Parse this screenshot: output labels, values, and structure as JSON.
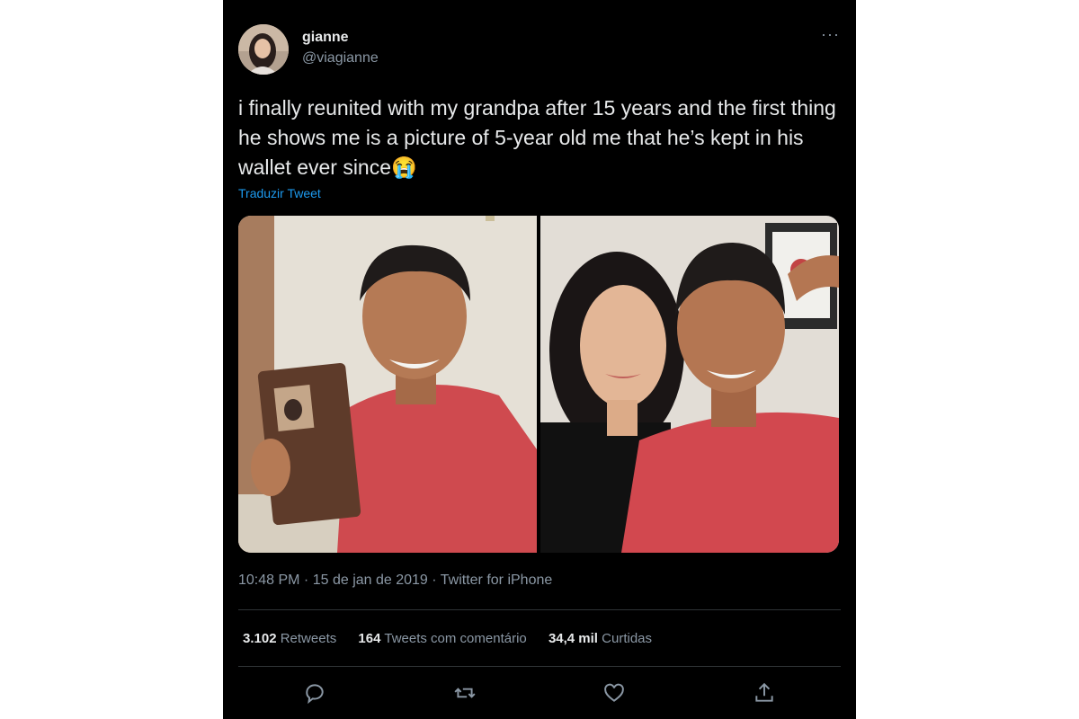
{
  "author": {
    "name": "gianne",
    "handle": "@viagianne"
  },
  "more_label": "···",
  "tweet": {
    "text": "i finally reunited with my grandpa after 15 years and the first thing he shows me is a picture of 5-year old me that he’s kept in his wallet ever since😭",
    "translate": "Traduzir Tweet"
  },
  "meta": {
    "time": "10:48 PM",
    "sep1": " · ",
    "date": "15 de jan de 2019",
    "sep2": " · ",
    "source": "Twitter for iPhone"
  },
  "stats": {
    "retweets_count": "3.102",
    "retweets_label": "Retweets",
    "quotes_count": "164",
    "quotes_label": "Tweets com comentário",
    "likes_count": "34,4 mil",
    "likes_label": "Curtidas"
  },
  "icons": [
    "reply-icon",
    "retweet-icon",
    "like-icon",
    "share-icon"
  ],
  "colors": {
    "background": "#000000",
    "text": "#e7e9ea",
    "secondary": "#8b98a5",
    "link": "#1d9bf0",
    "divider": "#2f3336"
  }
}
